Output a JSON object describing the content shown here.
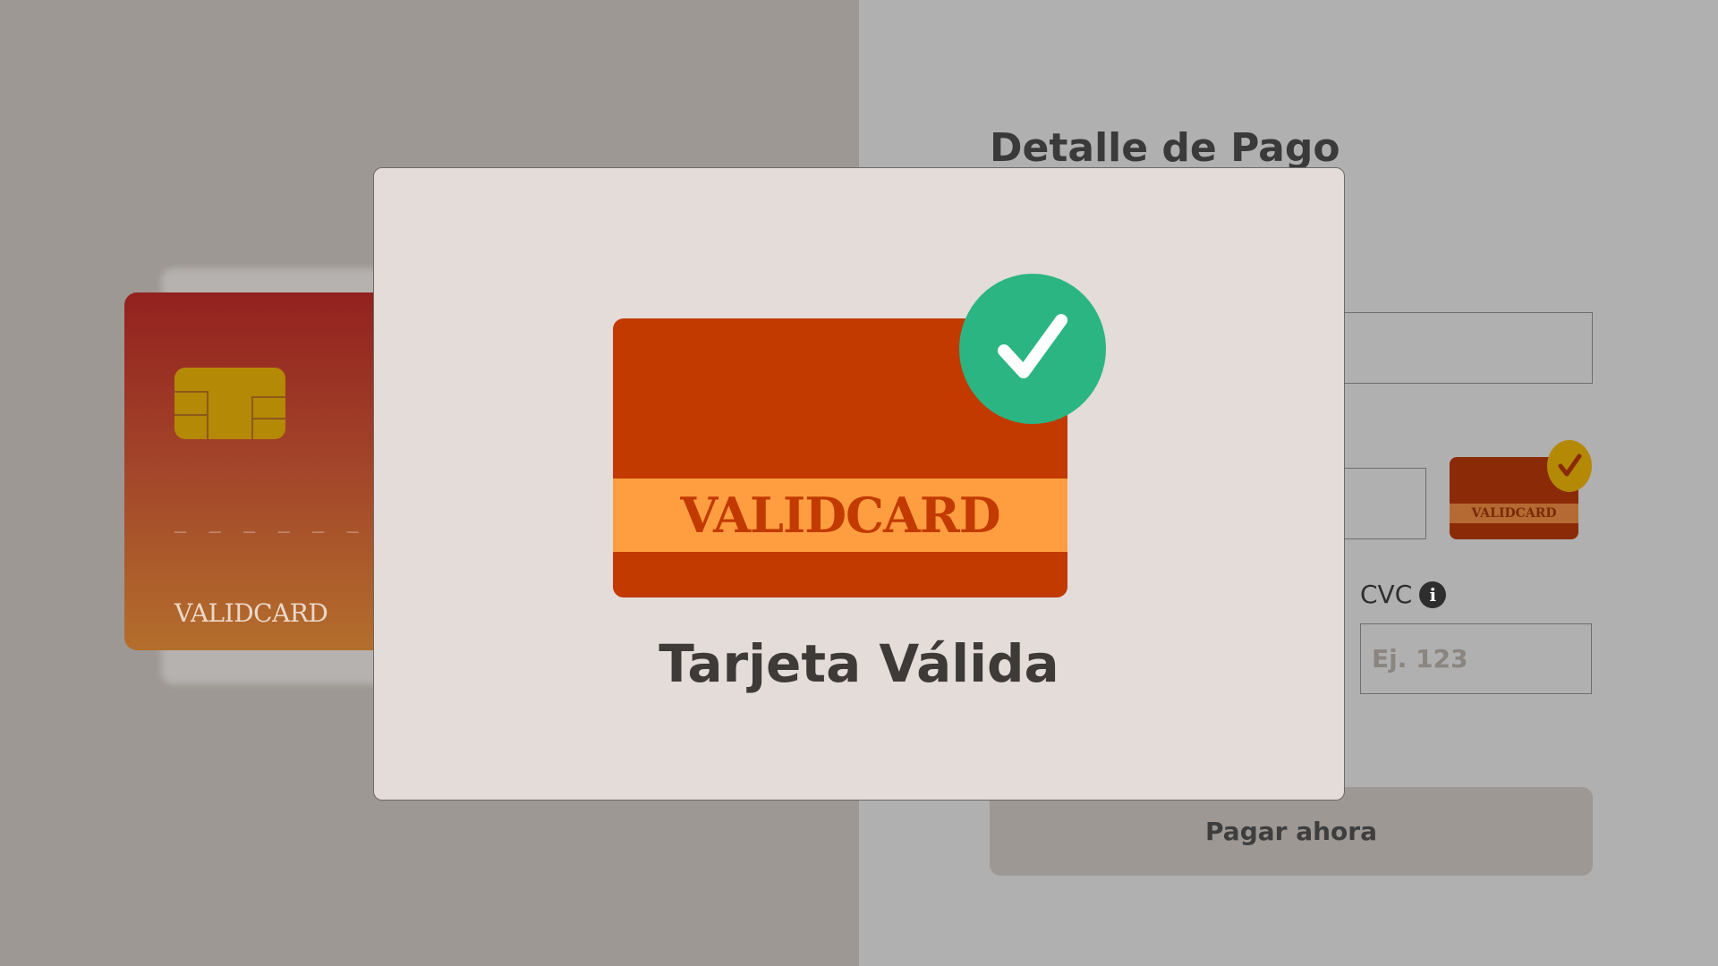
{
  "payment_form": {
    "title": "Detalle de Pago",
    "cvc_label": "CVC",
    "cvc_placeholder": "Ej. 123",
    "pay_button_label": "Pagar ahora",
    "mini_card_brand": "VALIDCARD"
  },
  "preview_card": {
    "number_mask": "_ _ _ _   _ _ _",
    "brand": "VALIDCARD"
  },
  "modal": {
    "card_brand": "VALIDCARD",
    "title": "Tarjeta Válida"
  },
  "colors": {
    "success_green": "#2bb582",
    "card_orange": "#c23a00",
    "card_band": "#fe9e40",
    "gold_accent": "#b48905"
  },
  "icons": {
    "check": "check-icon",
    "info": "info-icon",
    "chip": "chip-icon"
  }
}
